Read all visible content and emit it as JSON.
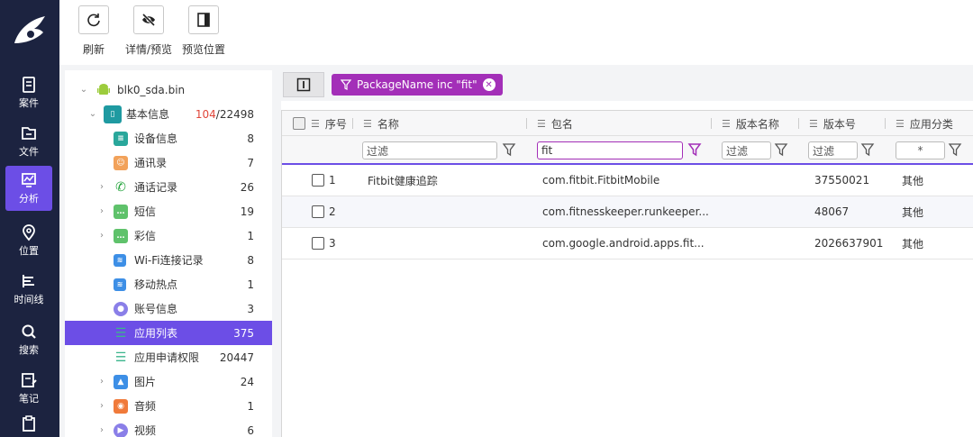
{
  "rail": {
    "items": [
      {
        "label": "案件",
        "icon": "case-icon"
      },
      {
        "label": "文件",
        "icon": "folder-icon"
      },
      {
        "label": "分析",
        "icon": "analysis-icon",
        "active": true
      },
      {
        "label": "位置",
        "icon": "location-icon"
      },
      {
        "label": "时间线",
        "icon": "timeline-icon"
      },
      {
        "label": "搜索",
        "icon": "search-icon"
      },
      {
        "label": "笔记",
        "icon": "notes-icon"
      }
    ]
  },
  "toolbar": {
    "refresh_label": "刷新",
    "detail_label": "详情/预览",
    "preview_pos_label": "预览位置"
  },
  "tree": {
    "root": "blk0_sda.bin",
    "basic": {
      "label": "基本信息",
      "count_red": "104",
      "count_total": "/22498"
    },
    "items": [
      {
        "label": "设备信息",
        "count": "8"
      },
      {
        "label": "通讯录",
        "count": "7"
      },
      {
        "label": "通话记录",
        "count": "26"
      },
      {
        "label": "短信",
        "count": "19"
      },
      {
        "label": "彩信",
        "count": "1"
      },
      {
        "label": "Wi-Fi连接记录",
        "count": "8"
      },
      {
        "label": "移动热点",
        "count": "1"
      },
      {
        "label": "账号信息",
        "count": "3"
      },
      {
        "label": "应用列表",
        "count": "375"
      },
      {
        "label": "应用申请权限",
        "count": "20447"
      },
      {
        "label": "图片",
        "count": "24"
      },
      {
        "label": "音频",
        "count": "1"
      },
      {
        "label": "视频",
        "count": "6"
      }
    ]
  },
  "filter_chip": "PackageName inc \"fit\"",
  "grid": {
    "columns": [
      "序号",
      "名称",
      "包名",
      "版本名称",
      "版本号",
      "应用分类"
    ],
    "filters": {
      "name_placeholder": "过滤",
      "package_value": "fit",
      "vername_placeholder": "过滤",
      "vercode_placeholder": "过滤",
      "category_value": "*"
    },
    "rows": [
      {
        "index": "1",
        "name": "Fitbit健康追踪",
        "package": "com.fitbit.FitbitMobile",
        "version_name": "",
        "version_code": "37550021",
        "category": "其他"
      },
      {
        "index": "2",
        "name": "",
        "package": "com.fitnesskeeper.runkeeper...",
        "version_name": "",
        "version_code": "48067",
        "category": "其他"
      },
      {
        "index": "3",
        "name": "",
        "package": "com.google.android.apps.fit...",
        "version_name": "",
        "version_code": "2026637901",
        "category": "其他"
      }
    ]
  },
  "colors": {
    "accent": "#6c4ee6",
    "filter": "#a32fb8",
    "rail": "#1c2340"
  }
}
